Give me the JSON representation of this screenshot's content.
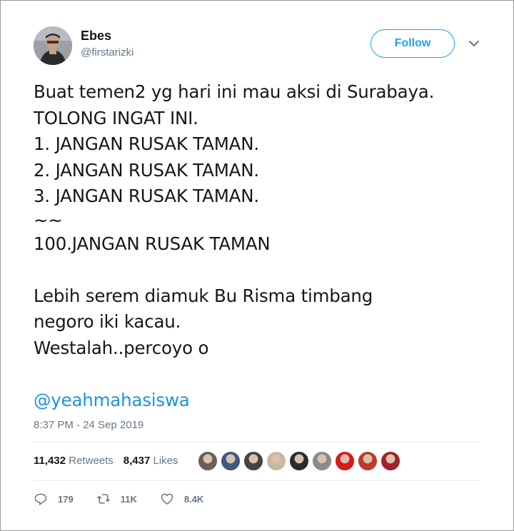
{
  "author": {
    "name": "Ebes",
    "handle": "@firstarizki",
    "avatar_icon": "user-avatar"
  },
  "follow_button": {
    "label": "Follow"
  },
  "menu_icon": "chevron-down-icon",
  "tweet": {
    "lines": [
      "Buat temen2 yg hari ini mau aksi di Surabaya.",
      "TOLONG INGAT INI.",
      "1. JANGAN RUSAK TAMAN.",
      "2. JANGAN RUSAK TAMAN.",
      "3. JANGAN RUSAK TAMAN.",
      "~~",
      "100.JANGAN RUSAK TAMAN",
      "Lebih serem diamuk Bu Risma timbang",
      "negoro iki kacau.",
      "Westalah..percoyo o"
    ],
    "mention": "@yeahmahasiswa"
  },
  "timestamp": "8:37 PM - 24 Sep 2019",
  "stats": {
    "retweets_count": "11,432",
    "retweets_label": "Retweets",
    "likes_count": "8,437",
    "likes_label": "Likes"
  },
  "likers": [
    {
      "color": "#6b5e57"
    },
    {
      "color": "#3d5a80"
    },
    {
      "color": "#444444"
    },
    {
      "color": "#c9b7a3"
    },
    {
      "color": "#2b2b2b"
    },
    {
      "color": "#8a8a8a"
    },
    {
      "color": "#d61a1a"
    },
    {
      "color": "#c0392b"
    },
    {
      "color": "#a0222c"
    }
  ],
  "actions": {
    "replies": "179",
    "retweets": "11K",
    "likes": "8.4K"
  },
  "colors": {
    "accent": "#1da1f2",
    "mention": "#1b95e0",
    "secondary_text": "#657786"
  }
}
